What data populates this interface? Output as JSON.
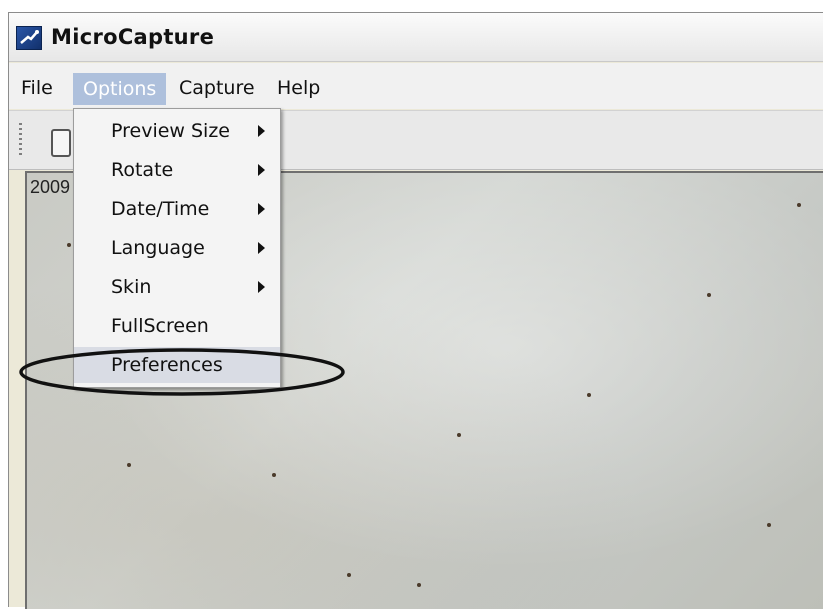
{
  "window": {
    "title": "MicroCapture",
    "icon": "microscope-app-icon"
  },
  "menubar": {
    "items": [
      {
        "label": "File"
      },
      {
        "label": "Options"
      },
      {
        "label": "Capture"
      },
      {
        "label": "Help"
      }
    ]
  },
  "toolbar": {
    "button_icon": "capture-tool-icon"
  },
  "preview": {
    "overlay_text": "2009"
  },
  "options_menu": {
    "items": [
      {
        "label": "Preview Size",
        "submenu": true
      },
      {
        "label": "Rotate",
        "submenu": true
      },
      {
        "label": "Date/Time",
        "submenu": true
      },
      {
        "label": "Language",
        "submenu": true
      },
      {
        "label": "Skin",
        "submenu": true
      },
      {
        "label": "FullScreen",
        "submenu": false
      },
      {
        "label": "Preferences",
        "submenu": false,
        "highlighted": true
      }
    ]
  },
  "annotation": {
    "shape": "ellipse",
    "target": "Preferences",
    "color": "#111111"
  }
}
